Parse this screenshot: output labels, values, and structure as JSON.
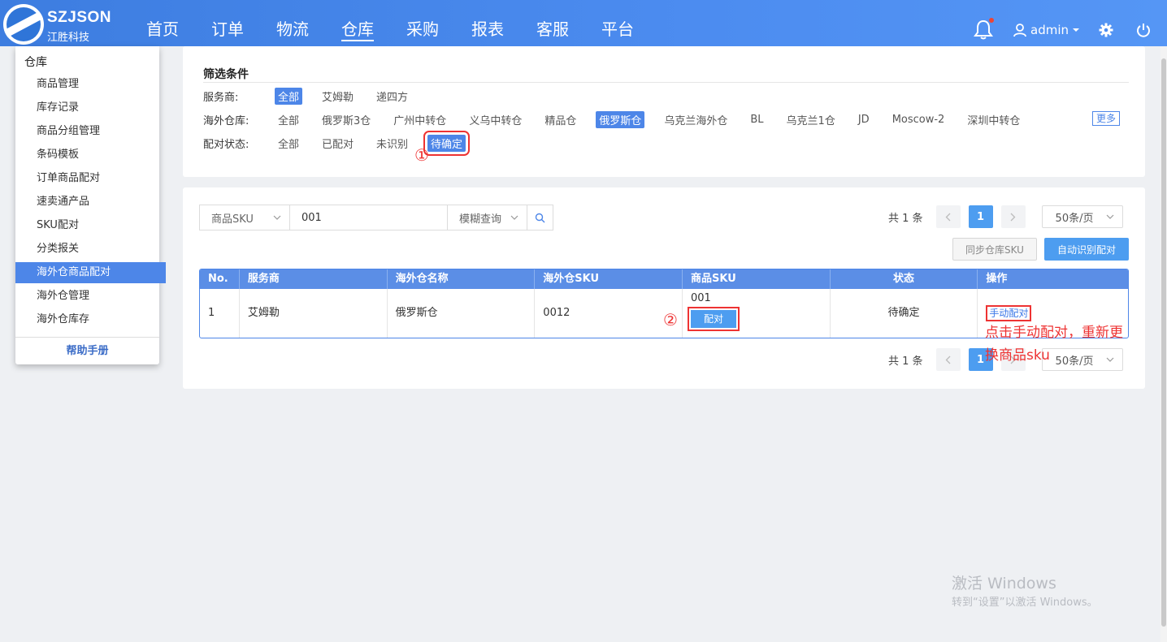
{
  "brand": {
    "name": "SZJSON",
    "sub": "江胜科技"
  },
  "nav": [
    {
      "label": "首页"
    },
    {
      "label": "订单"
    },
    {
      "label": "物流"
    },
    {
      "label": "仓库"
    },
    {
      "label": "采购"
    },
    {
      "label": "报表"
    },
    {
      "label": "客服"
    },
    {
      "label": "平台"
    }
  ],
  "nav_active": "仓库",
  "header": {
    "user": "admin"
  },
  "icons": [
    "bell-icon",
    "user-icon",
    "chevron-down-icon",
    "gear-icon",
    "power-icon",
    "search-icon",
    "chevron-left-icon",
    "chevron-right-icon"
  ],
  "sidebar": {
    "title": "仓库",
    "items": [
      {
        "label": "商品管理"
      },
      {
        "label": "库存记录"
      },
      {
        "label": "商品分组管理"
      },
      {
        "label": "条码模板"
      },
      {
        "label": "订单商品配对"
      },
      {
        "label": "速卖通产品"
      },
      {
        "label": "SKU配对"
      },
      {
        "label": "分类报关"
      },
      {
        "label": "海外仓商品配对"
      },
      {
        "label": "海外仓管理"
      },
      {
        "label": "海外仓库存"
      }
    ],
    "active": "海外仓商品配对",
    "help": "帮助手册"
  },
  "filter": {
    "title": "筛选条件",
    "provider_label": "服务商:",
    "providers": [
      "全部",
      "艾姆勒",
      "递四方"
    ],
    "warehouse_label": "海外仓库:",
    "warehouses": [
      "全部",
      "俄罗斯3仓",
      "广州中转仓",
      "义乌中转仓",
      "精品仓",
      "俄罗斯仓",
      "乌克兰海外仓",
      "BL",
      "乌克兰1仓",
      "JD",
      "Moscow-2",
      "深圳中转仓"
    ],
    "more": "更多",
    "status_label": "配对状态:",
    "statuses": [
      "全部",
      "已配对",
      "未识别",
      "待确定"
    ]
  },
  "annotations": {
    "one": "①",
    "two": "②",
    "note": "点击手动配对，重新更换商品sku"
  },
  "search": {
    "field": "商品SKU",
    "value": "001",
    "mode": "模糊查询"
  },
  "pager": {
    "total": "共 1 条",
    "current": "1",
    "page_size": "50条/页"
  },
  "buttons": {
    "sync": "同步仓库SKU",
    "auto": "自动识别配对"
  },
  "table": {
    "headers": [
      "No.",
      "服务商",
      "海外仓名称",
      "海外仓SKU",
      "商品SKU",
      "状态",
      "操作"
    ],
    "rows": [
      {
        "no": "1",
        "provider": "艾姆勒",
        "warehouse": "俄罗斯仓",
        "wsku": "0012",
        "sku": "001",
        "pair": "配对",
        "status": "待确定",
        "action": "手动配对"
      }
    ]
  },
  "watermark": {
    "line1": "激活 Windows",
    "line2": "转到“设置”以激活 Windows。"
  },
  "colors": {
    "header": "#4c8cf0",
    "accent": "#4d86e8",
    "primary_button": "#4d9df0",
    "annotation": "#e33333"
  }
}
